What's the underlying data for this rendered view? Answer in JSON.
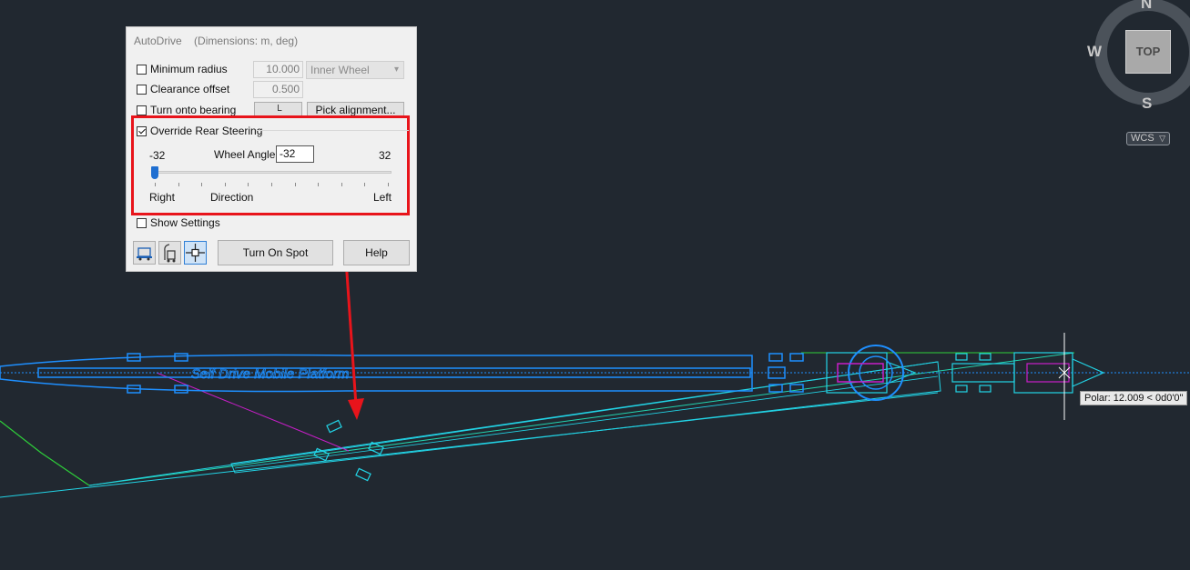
{
  "dialog": {
    "title": "AutoDrive",
    "dimensions": "(Dimensions: m, deg)",
    "min_radius": {
      "label": "Minimum radius",
      "value": "10.000",
      "checked": false
    },
    "wheel_select": {
      "value": "Inner Wheel"
    },
    "clearance": {
      "label": "Clearance offset",
      "value": "0.500",
      "checked": false
    },
    "turn_bearing": {
      "label": "Turn onto bearing",
      "checked": false
    },
    "pick_alignment_label": "Pick alignment...",
    "override": {
      "label": "Override Rear Steering",
      "checked": true
    },
    "slider": {
      "min_label": "-32",
      "max_label": "32",
      "wheel_angle_label": "Wheel Angle",
      "wheel_angle_value": "-32",
      "value": -32,
      "min": -32,
      "max": 32,
      "right_label": "Right",
      "direction_label": "Direction",
      "left_label": "Left"
    },
    "show_settings": {
      "label": "Show Settings",
      "checked": false
    },
    "turn_on_spot_label": "Turn On Spot",
    "help_label": "Help",
    "icons": [
      "vehicle-icon",
      "vehicle-side-icon",
      "crosshair-icon"
    ]
  },
  "viewcube": {
    "top_label": "TOP",
    "north": "N",
    "south": "S",
    "west": "W",
    "wcs_label": "WCS"
  },
  "tooltip": "Polar: 12.009 < 0d0'0\"",
  "vehicle_label": "Self Drive Mobile Platform",
  "colors": {
    "background": "#212830",
    "vehicle_blue": "#1e8fff",
    "path_cyan": "#22d4e6",
    "path_green": "#2ecf3a",
    "magenta": "#c81ec8",
    "highlight_red": "#e8141b"
  }
}
